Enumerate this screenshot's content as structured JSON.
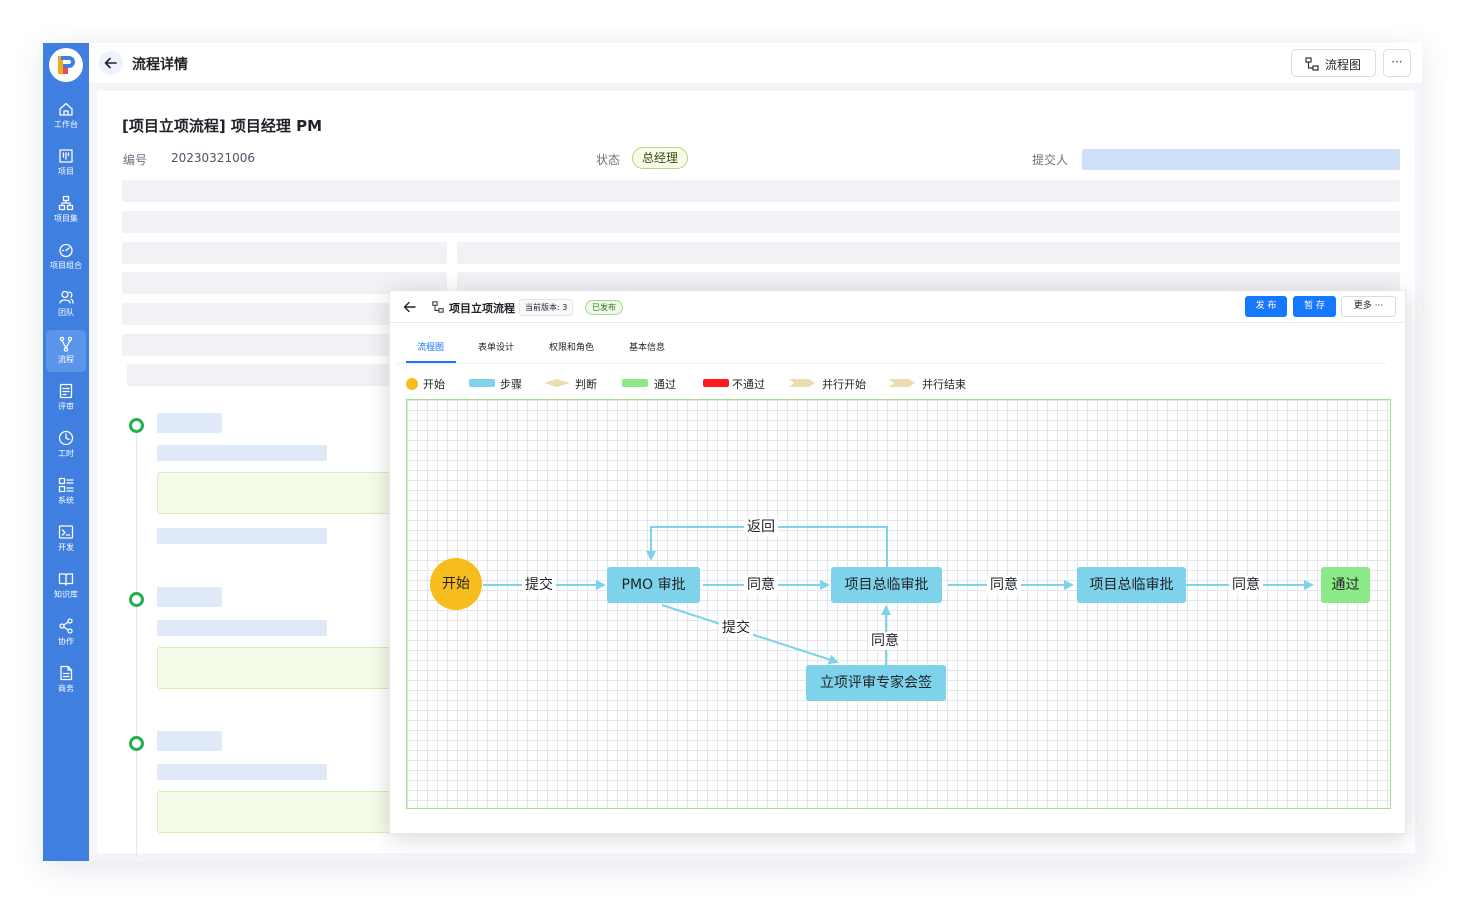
{
  "app": {
    "page_title": "流程详情",
    "flow_chart_button": "流程图",
    "more_button": "···"
  },
  "colors": {
    "sidebar": "#3f7fe0",
    "primary": "#1677ff",
    "step": "#7ed2ea",
    "start": "#f7bd1e",
    "pass": "#8cea86",
    "reject": "#ff1a1a",
    "parallel": "#ecdcb0"
  },
  "sidebar": {
    "items": [
      {
        "label": "工作台",
        "icon": "home-icon"
      },
      {
        "label": "项目",
        "icon": "kanban-icon"
      },
      {
        "label": "项目集",
        "icon": "hierarchy-icon"
      },
      {
        "label": "项目组合",
        "icon": "gauge-icon"
      },
      {
        "label": "团队",
        "icon": "team-icon"
      },
      {
        "label": "流程",
        "icon": "flow-icon",
        "active": true
      },
      {
        "label": "评审",
        "icon": "review-icon"
      },
      {
        "label": "工时",
        "icon": "clock-icon"
      },
      {
        "label": "系统",
        "icon": "system-icon"
      },
      {
        "label": "开发",
        "icon": "terminal-icon"
      },
      {
        "label": "知识库",
        "icon": "book-icon"
      },
      {
        "label": "协作",
        "icon": "share-icon"
      },
      {
        "label": "商务",
        "icon": "document-icon"
      }
    ]
  },
  "document": {
    "title": "[项目立项流程] 项目经理 PM",
    "number_label": "编号",
    "number_value": "20230321006",
    "status_label": "状态",
    "status_value": "总经理",
    "submitter_label": "提交人"
  },
  "modal": {
    "title": "项目立项流程",
    "version": "当前版本: 3",
    "published": "已发布",
    "publish_button": "发 布",
    "save_button": "暂 存",
    "more_button": "更多 ···",
    "tabs": [
      "流程图",
      "表单设计",
      "权限和角色",
      "基本信息"
    ],
    "active_tab": 0,
    "legend": [
      {
        "label": "开始",
        "kind": "circle",
        "color": "#f7bd1e"
      },
      {
        "label": "步骤",
        "kind": "rect",
        "color": "#7ed2ea"
      },
      {
        "label": "判断",
        "kind": "diamond",
        "color": "#ecdcb0"
      },
      {
        "label": "通过",
        "kind": "rect",
        "color": "#8cea86"
      },
      {
        "label": "不通过",
        "kind": "rect",
        "color": "#ff1a1a"
      },
      {
        "label": "并行开始",
        "kind": "chevron",
        "color": "#ecdcb0"
      },
      {
        "label": "并行结束",
        "kind": "chevron",
        "color": "#ecdcb0"
      }
    ],
    "flow": {
      "nodes": {
        "start": "开始",
        "pmo": "PMO 审批",
        "approve1": "项目总临审批",
        "approve2": "项目总临审批",
        "expert": "立项评审专家会签",
        "pass": "通过"
      },
      "edges": {
        "submit1": "提交",
        "agree1": "同意",
        "return": "返回",
        "submit2": "提交",
        "agree_expert": "同意",
        "agree2": "同意",
        "agree3": "同意"
      }
    }
  }
}
